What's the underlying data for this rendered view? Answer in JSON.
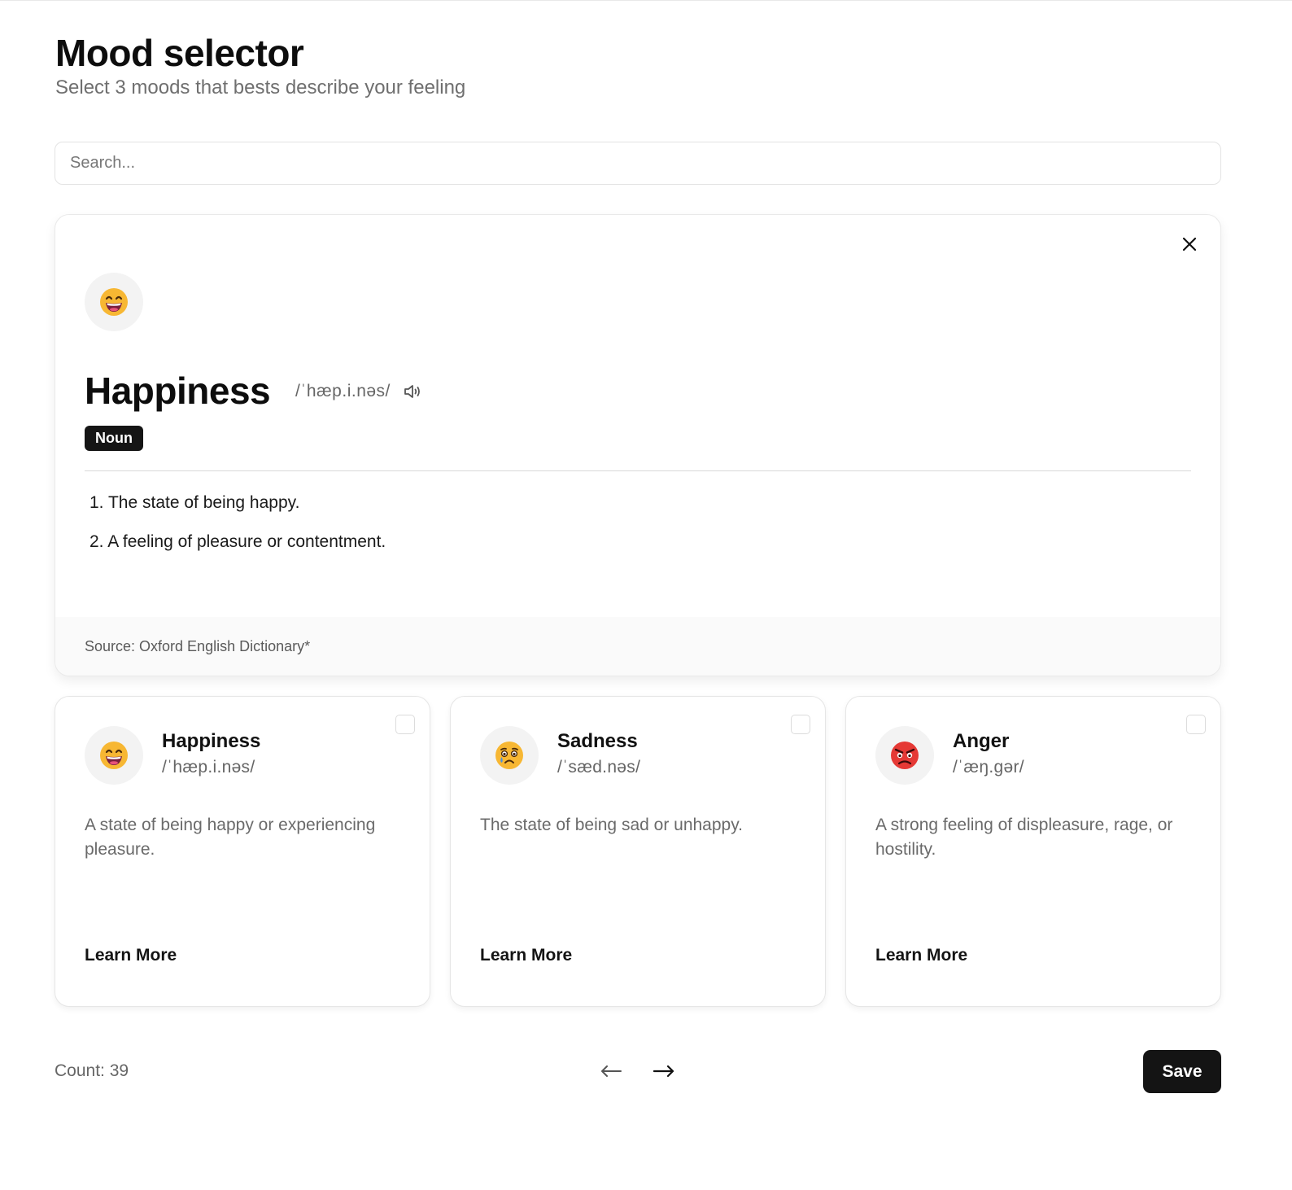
{
  "header": {
    "title": "Mood selector",
    "subtitle": "Select 3 moods that bests describe your feeling"
  },
  "search": {
    "placeholder": "Search...",
    "value": ""
  },
  "detail": {
    "emoji_icon": "grinning-face-icon",
    "word": "Happiness",
    "phonetic": "/ˈhæp.i.nəs/",
    "part_of_speech": "Noun",
    "definitions": [
      "The state of being happy.",
      "A feeling of pleasure or contentment."
    ],
    "source": "Source: Oxford English Dictionary*"
  },
  "cards": [
    {
      "emoji_icon": "grinning-face-icon",
      "name": "Happiness",
      "phonetic": "/ˈhæp.i.nəs/",
      "description": "A state of being happy or experiencing pleasure.",
      "link_label": "Learn More",
      "checked": false
    },
    {
      "emoji_icon": "crying-face-icon",
      "name": "Sadness",
      "phonetic": "/ˈsæd.nəs/",
      "description": "The state of being sad or unhappy.",
      "link_label": "Learn More",
      "checked": false
    },
    {
      "emoji_icon": "angry-face-icon",
      "name": "Anger",
      "phonetic": "/ˈæŋ.gər/",
      "description": "A strong feeling of displeasure, rage, or hostility.",
      "link_label": "Learn More",
      "checked": false
    }
  ],
  "footer": {
    "count_label": "Count: 39",
    "save_label": "Save"
  },
  "colors": {
    "primary_dark": "#141414",
    "emoji_yellow": "#f7b733",
    "emoji_red": "#e53935",
    "muted_text": "#6a6a6a"
  }
}
